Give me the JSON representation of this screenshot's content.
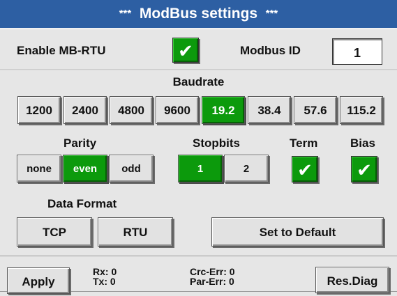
{
  "header": {
    "stars_left": "***",
    "title": "ModBus settings",
    "stars_right": "***"
  },
  "top": {
    "enable_label": "Enable MB-RTU",
    "enable_checked": true,
    "modbus_id_label": "Modbus ID",
    "modbus_id_value": "1"
  },
  "baudrate": {
    "label": "Baudrate",
    "options": [
      "1200",
      "2400",
      "4800",
      "9600",
      "19.2",
      "38.4",
      "57.6",
      "115.2"
    ],
    "selected": "19.2"
  },
  "parity": {
    "label": "Parity",
    "options": [
      "none",
      "even",
      "odd"
    ],
    "selected": "even"
  },
  "stopbits": {
    "label": "Stopbits",
    "options": [
      "1",
      "2"
    ],
    "selected": "1"
  },
  "term": {
    "label": "Term",
    "checked": true
  },
  "bias": {
    "label": "Bias",
    "checked": true
  },
  "data_format": {
    "label": "Data Format",
    "options": [
      "TCP",
      "RTU"
    ],
    "set_default_label": "Set to Default"
  },
  "footer": {
    "apply_label": "Apply",
    "rx": "Rx: 0",
    "tx": "Tx: 0",
    "crc_err": "Crc-Err: 0",
    "par_err": "Par-Err: 0",
    "res_diag_label": "Res.Diag"
  },
  "checkmark_glyph": "✔",
  "colors": {
    "header": "#2d5fa3",
    "selected": "#0c9a0c",
    "background": "#e6e6e6"
  }
}
